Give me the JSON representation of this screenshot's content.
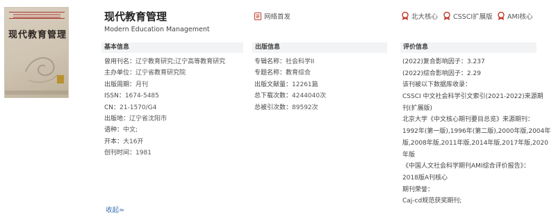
{
  "journal": {
    "title": "现代教育管理",
    "subtitle": "Modern Education Management",
    "cover_title": "现代教育管理"
  },
  "badges": {
    "first_release": "网络首发",
    "pku_core": "北大核心",
    "cssci_ext": "CSSCI扩展版",
    "ami_core": "AMI核心"
  },
  "sections": {
    "basic": "基本信息",
    "publication": "出版信息",
    "evaluation": "评价信息"
  },
  "basic": {
    "former_name_label": "曾用刊名：",
    "former_name_1": "辽宁教育研究",
    "sep": ";",
    "former_name_2": "辽宁高等教育研究",
    "sponsor_label": "主办单位：",
    "sponsor": "辽宁省教育研究院",
    "cycle_label": "出版周期：",
    "cycle": "月刊",
    "issn_label": "ISSN：",
    "issn": "1674-5485",
    "cn_label": "CN：",
    "cn": "21-1570/G4",
    "place_label": "出版地：",
    "place": "辽宁省沈阳市",
    "language_label": "语种：",
    "language": "中文;",
    "format_label": "开本：",
    "format": "大16开",
    "founded_label": "创刊时间：",
    "founded": "1981"
  },
  "publication": {
    "subject_label": "专辑名称：",
    "subject": "社会科学II",
    "topic_label": "专题名称：",
    "topic": "教育综合",
    "articles_label": "出版文献量：",
    "articles": "12261篇",
    "downloads_label": "总下载次数：",
    "downloads": "4244040次",
    "citations_label": "总被引次数：",
    "citations": "89592次"
  },
  "evaluation": {
    "lines": [
      "(2022)复合影响因子：3.237",
      "(2022)综合影响因子：2.29",
      "该刊被以下数据库收录：",
      "CSSCI 中文社会科学引文索引(2021-2022)来源期",
      "刊(扩展版)",
      "北京大学《中文核心期刊要目总览》来源期刊：",
      "1992年(第一版),1996年(第二版),2000年版,2004年",
      "版,2008年版,2011年版,2014年版,2017年版,2020",
      "年版",
      "《中国人文社会科学期刊AMI综合评价报告》：",
      "2018版A刊核心",
      "期刊荣誉：",
      "Caj-cd规范获奖期刊;"
    ]
  },
  "collapse_label": "收起≈",
  "colors": {
    "accent_red": "#c0392b",
    "link_blue": "#3a6fb5",
    "panel_bg": "#f2f3f5"
  }
}
